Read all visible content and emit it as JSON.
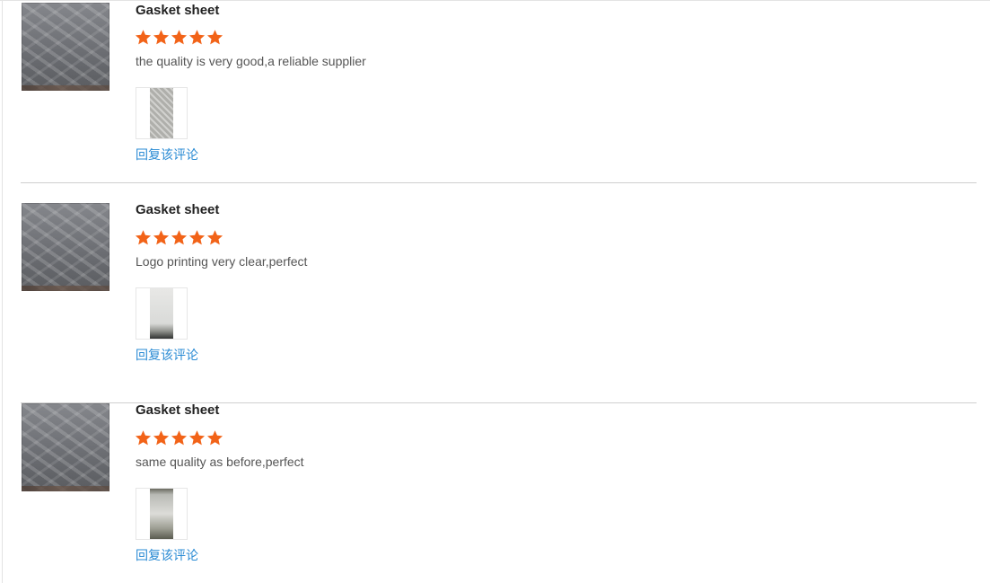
{
  "colors": {
    "star": "#f26318",
    "link": "#2a8bd4",
    "divider": "#cfcfcf"
  },
  "reviews": [
    {
      "product_name": "Gasket sheet",
      "rating": 5,
      "rating_max": 5,
      "comment": "the quality is very good,a reliable supplier",
      "reply_label": "回复该评论"
    },
    {
      "product_name": "Gasket sheet",
      "rating": 5,
      "rating_max": 5,
      "comment": "Logo printing very clear,perfect",
      "reply_label": "回复该评论"
    },
    {
      "product_name": "Gasket sheet",
      "rating": 5,
      "rating_max": 5,
      "comment": "same quality as before,perfect",
      "reply_label": "回复该评论"
    }
  ]
}
